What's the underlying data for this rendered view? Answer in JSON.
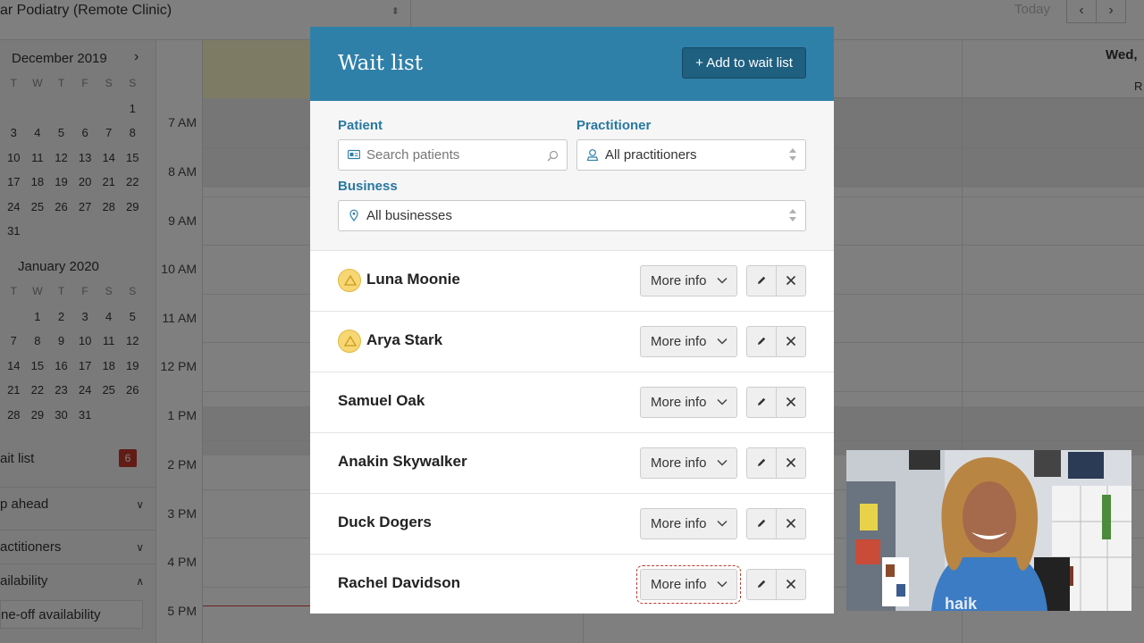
{
  "topbar": {
    "clinic": "ar Podiatry (Remote Clinic)",
    "today": "Today"
  },
  "sidebar": {
    "months": [
      {
        "title": "December 2019",
        "weekdays": [
          "T",
          "W",
          "T",
          "F",
          "S",
          "S"
        ],
        "days": [
          "",
          "",
          "",
          "",
          "",
          "1",
          "3",
          "4",
          "5",
          "6",
          "7",
          "8",
          "10",
          "11",
          "12",
          "13",
          "14",
          "15",
          "17",
          "18",
          "19",
          "20",
          "21",
          "22",
          "24",
          "25",
          "26",
          "27",
          "28",
          "29",
          "31",
          "",
          "",
          "",
          "",
          ""
        ]
      },
      {
        "title": "January 2020",
        "weekdays": [
          "T",
          "W",
          "T",
          "F",
          "S",
          "S"
        ],
        "days": [
          "",
          "1",
          "2",
          "3",
          "4",
          "5",
          "7",
          "8",
          "9",
          "10",
          "11",
          "12",
          "14",
          "15",
          "16",
          "17",
          "18",
          "19",
          "21",
          "22",
          "23",
          "24",
          "25",
          "26",
          "28",
          "29",
          "30",
          "31",
          "",
          ""
        ]
      }
    ],
    "wait_list_label": "ait list",
    "wait_list_count": "6",
    "items": [
      "p ahead",
      "actitioners",
      "ailability"
    ],
    "one_off": "ne-off availability"
  },
  "calendar": {
    "times": [
      "7 AM",
      "8 AM",
      "9 AM",
      "10 AM",
      "11 AM",
      "12 PM",
      "1 PM",
      "2 PM",
      "3 PM",
      "4 PM",
      "5 PM"
    ],
    "day_header": "Wed,",
    "day_sub": "R"
  },
  "modal": {
    "title": "Wait list",
    "add_button": "+ Add to wait list",
    "filters": {
      "patient_label": "Patient",
      "patient_placeholder": "Search patients",
      "practitioner_label": "Practitioner",
      "practitioner_value": "All practitioners",
      "business_label": "Business",
      "business_value": "All businesses"
    },
    "patients": [
      {
        "name": "Luna Moonie",
        "alert": true
      },
      {
        "name": "Arya Stark",
        "alert": true
      },
      {
        "name": "Samuel Oak",
        "alert": false
      },
      {
        "name": "Anakin Skywalker",
        "alert": false
      },
      {
        "name": "Duck Dogers",
        "alert": false
      },
      {
        "name": "Rachel Davidson",
        "alert": false
      }
    ],
    "more_info_label": "More info"
  },
  "colors": {
    "header": "#2f80a8",
    "add_button": "#1f5f80",
    "label": "#2878a0",
    "alert": "#f7d773",
    "badge": "#c0392b"
  }
}
